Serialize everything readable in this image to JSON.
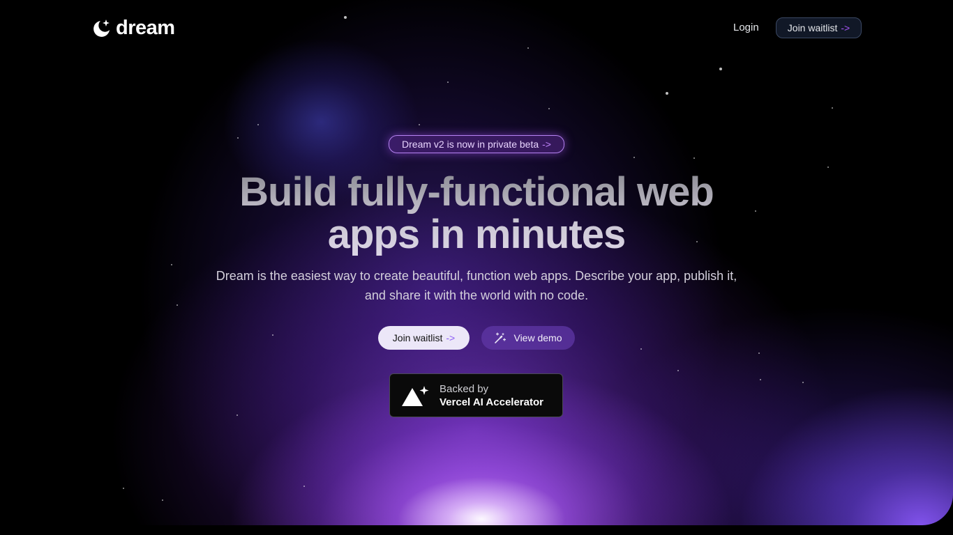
{
  "header": {
    "logo_text": "dream",
    "login_label": "Login",
    "join_label": "Join waitlist",
    "join_arrow": "->"
  },
  "announcement": {
    "text": "Dream v2 is now in private beta",
    "arrow": "->"
  },
  "hero": {
    "headline_line1": "Build fully-functional web",
    "headline_line2": "apps in minutes",
    "subtitle_line1": "Dream is the easiest way to create beautiful, function web apps. Describe your app, publish it,",
    "subtitle_line2": "and share it with the world with no code."
  },
  "cta": {
    "join_label": "Join waitlist",
    "join_arrow": "->",
    "demo_label": "View demo",
    "demo_icon": "magic-wand-icon"
  },
  "backed": {
    "line1": "Backed by",
    "line2": "Vercel AI Accelerator",
    "icon": "vercel-sparkle-icon"
  },
  "colors": {
    "background": "#000000",
    "accent": "#a855f7",
    "glow": "#c678ff",
    "primary_button": "#ece7f8"
  }
}
